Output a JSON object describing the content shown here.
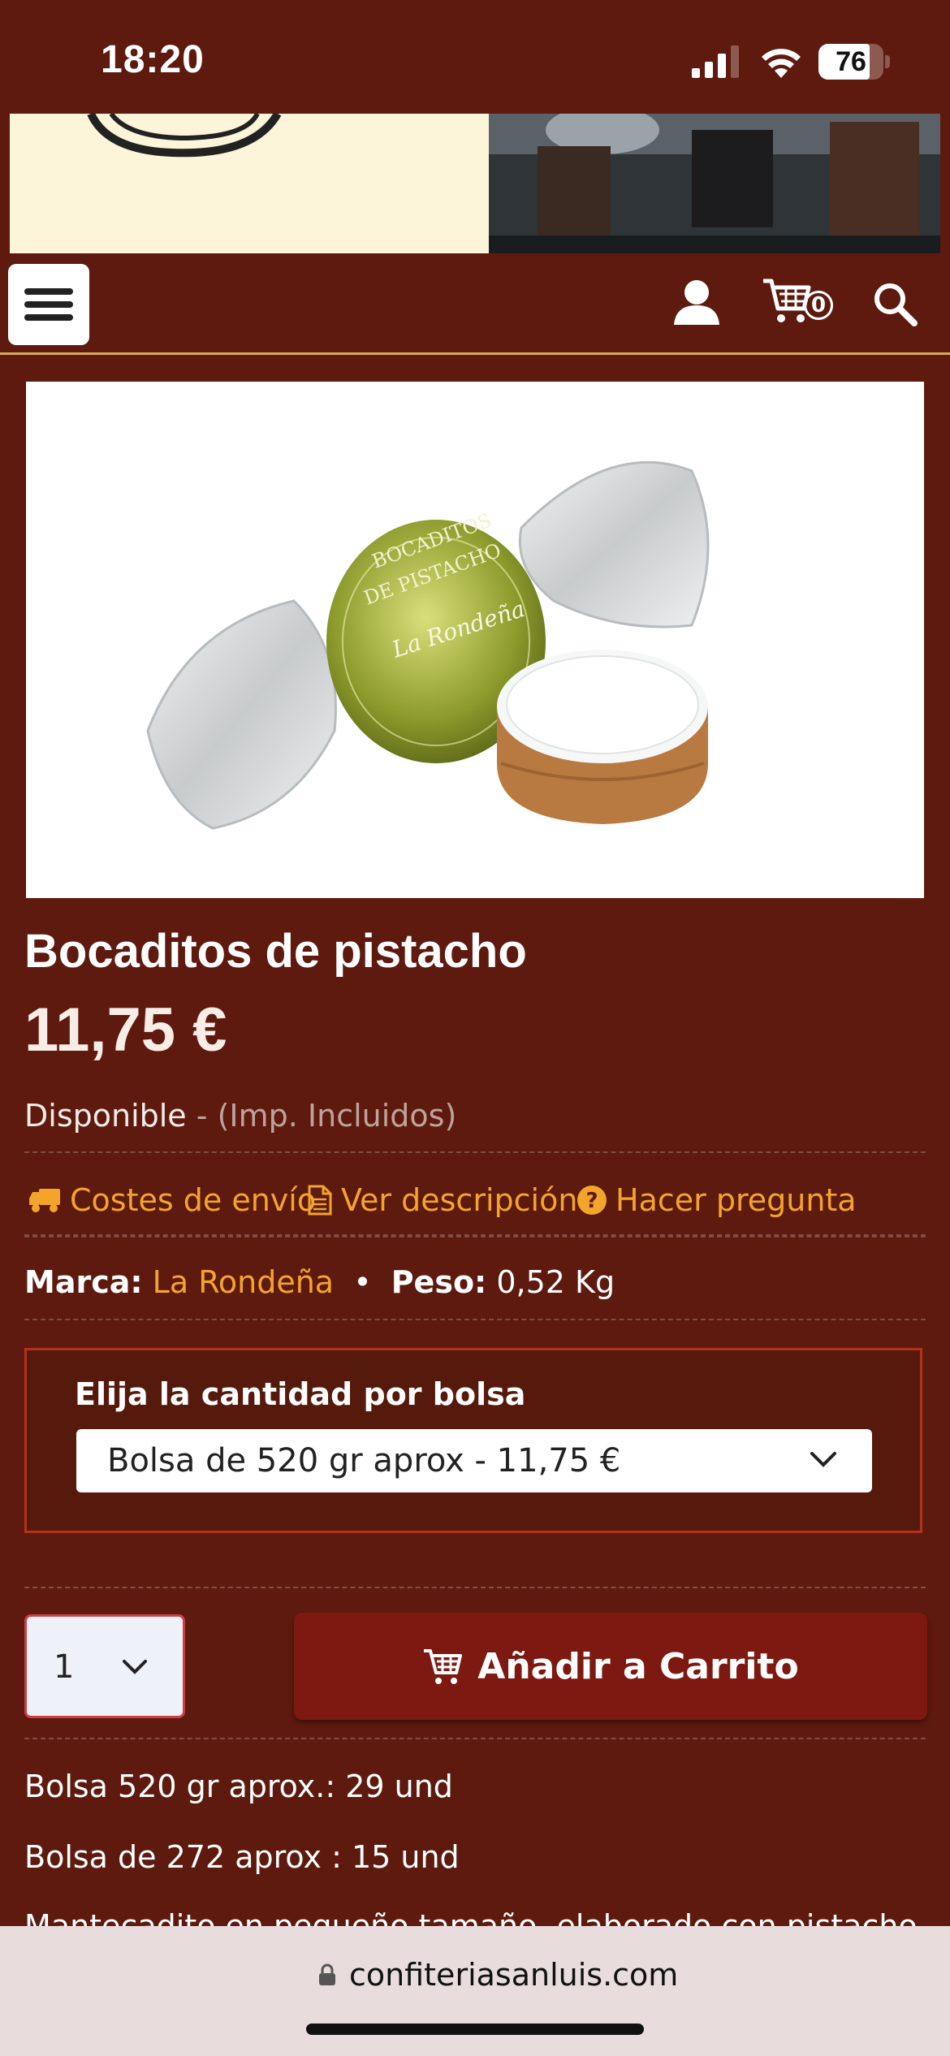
{
  "status_bar": {
    "time": "18:20",
    "battery": "76"
  },
  "nav": {
    "cart_count": "0"
  },
  "product": {
    "title": "Bocaditos de pistacho",
    "price": "11,75 €",
    "availability": "Disponible",
    "tax_note": "- (Imp. Incluidos)"
  },
  "links": {
    "shipping": "Costes de envío",
    "description": "Ver descripción",
    "question": "Hacer pregunta"
  },
  "specs": {
    "brand_label": "Marca:",
    "brand_value": "La Rondeña",
    "bullet": "•",
    "weight_label": "Peso:",
    "weight_value": "0,52 Kg"
  },
  "quantity_option": {
    "label": "Elija la cantidad por bolsa",
    "selected": "Bolsa de 520 gr aprox - 11,75 €"
  },
  "purchase": {
    "qty_value": "1",
    "add_to_cart_label": "Añadir a Carrito"
  },
  "info": {
    "line1": "Bolsa 520 gr aprox.: 29 und",
    "line2": "Bolsa de 272 aprox : 15 und",
    "line3": "Mantecadito en pequeño tamaño, elaborado con pistacho de"
  },
  "browser": {
    "url": "confiteriasanluis.com"
  },
  "image_text": {
    "wrapper_line1": "BOCADITOS",
    "wrapper_line2": "DE PISTACHO",
    "wrapper_brand": "La Rondeña"
  }
}
